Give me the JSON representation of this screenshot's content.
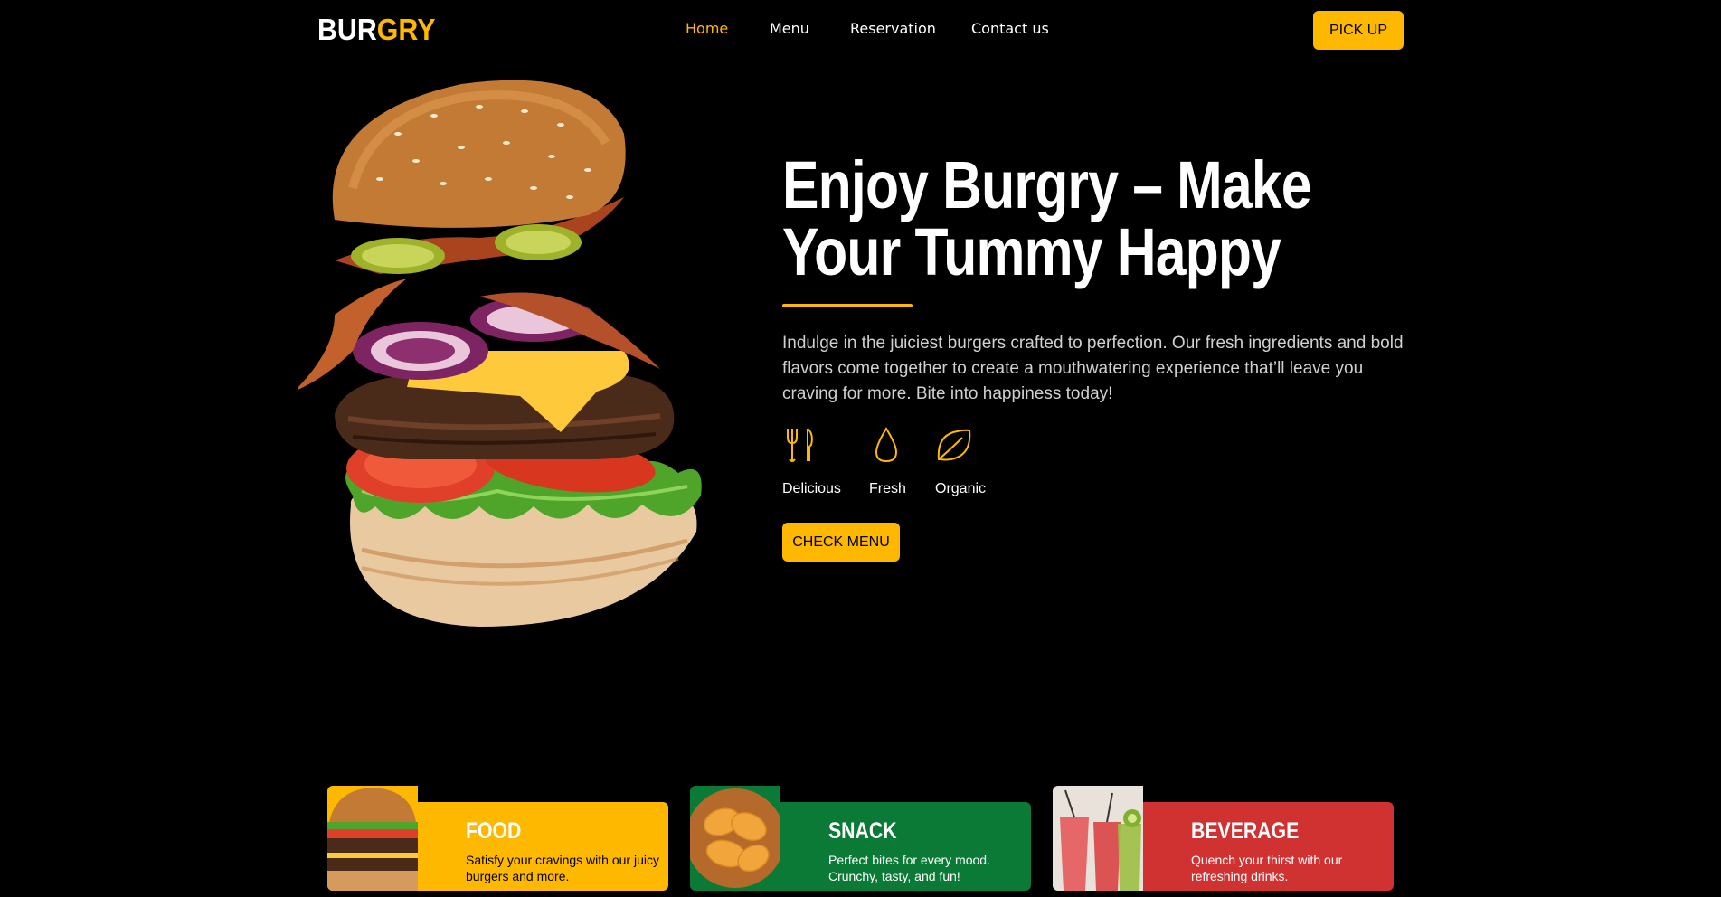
{
  "brand": {
    "logo_part1": "BUR",
    "logo_part2": "GRY"
  },
  "nav": {
    "items": [
      {
        "label": "Home",
        "active": true
      },
      {
        "label": "Menu",
        "active": false
      },
      {
        "label": "Reservation",
        "active": false
      },
      {
        "label": "Contact us",
        "active": false
      }
    ],
    "pickup_label": "PICK UP"
  },
  "hero": {
    "headline_line1": "Enjoy Burgry – Make",
    "headline_line2": "Your Tummy Happy",
    "description": "Indulge in the juiciest burgers crafted to perfection. Our fresh ingredients and bold flavors come together to create a mouthwatering experience that’ll leave you craving for more. Bite into happiness today!",
    "features": [
      {
        "label": "Delicious",
        "icon": "fork-knife-icon"
      },
      {
        "label": "Fresh",
        "icon": "droplet-icon"
      },
      {
        "label": "Organic",
        "icon": "leaf-icon"
      }
    ],
    "cta_label": "CHECK MENU"
  },
  "categories": [
    {
      "title": "FOOD",
      "text": "Satisfy your cravings with our juicy burgers and more.",
      "color": "#FFB800"
    },
    {
      "title": "SNACK",
      "text": "Perfect bites for every mood. Crunchy, tasty, and fun!",
      "color": "#0B7A36"
    },
    {
      "title": "BEVERAGE",
      "text": "Quench your thirst with our refreshing drinks.",
      "color": "#D03232"
    }
  ],
  "colors": {
    "accent": "#FFB800",
    "background": "#000000"
  }
}
